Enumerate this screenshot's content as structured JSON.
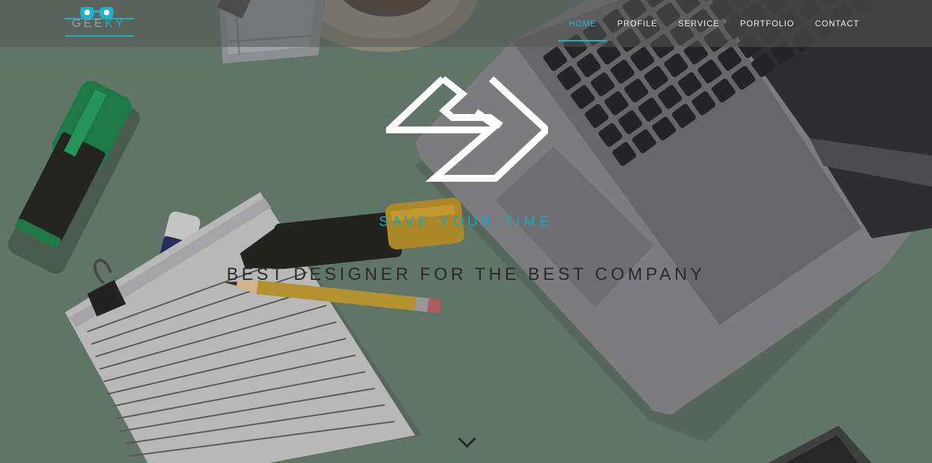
{
  "logo": {
    "text_a": "GEE",
    "text_b": "KY",
    "accent": "#1bb1c4"
  },
  "nav": {
    "items": [
      {
        "label": "HOME",
        "active": true
      },
      {
        "label": "PROFILE"
      },
      {
        "label": "SERVICE"
      },
      {
        "label": "PORTFOLIO"
      },
      {
        "label": "CONTACT"
      }
    ],
    "active_color": "#20b6c9"
  },
  "hero": {
    "tagline": "SAVE YOUR TIME",
    "headline": "BEST DESIGNER FOR THE BEST COMPANY",
    "scroll_icon": "chevron-down-icon",
    "background": "#5f7466"
  }
}
